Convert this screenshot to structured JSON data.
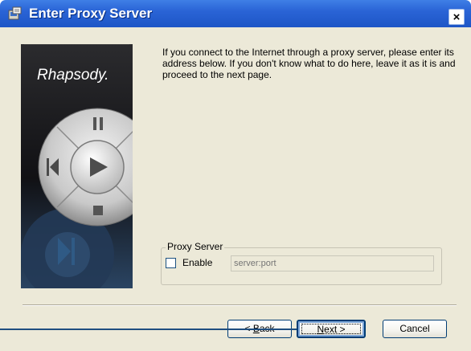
{
  "window": {
    "title": "Enter Proxy Server",
    "close_label": "×"
  },
  "logo": {
    "text": "Rhapsody."
  },
  "intro": {
    "text": "If you connect to the Internet through a proxy server, please enter its address below.  If you don't know what to do here, leave it as it is and proceed to the next page."
  },
  "proxy_group": {
    "legend": "Proxy Server",
    "enable_label": "Enable",
    "enabled": false,
    "address_placeholder": "server:port"
  },
  "buttons": {
    "back_pre": "< ",
    "back_key": "B",
    "back_post": "ack",
    "next_key": "N",
    "next_post": "ext >",
    "cancel": "Cancel"
  },
  "colors": {
    "title_bar": "#2a64d6",
    "dialog_bg": "#ece9d8",
    "callout": "#1f4e80"
  }
}
